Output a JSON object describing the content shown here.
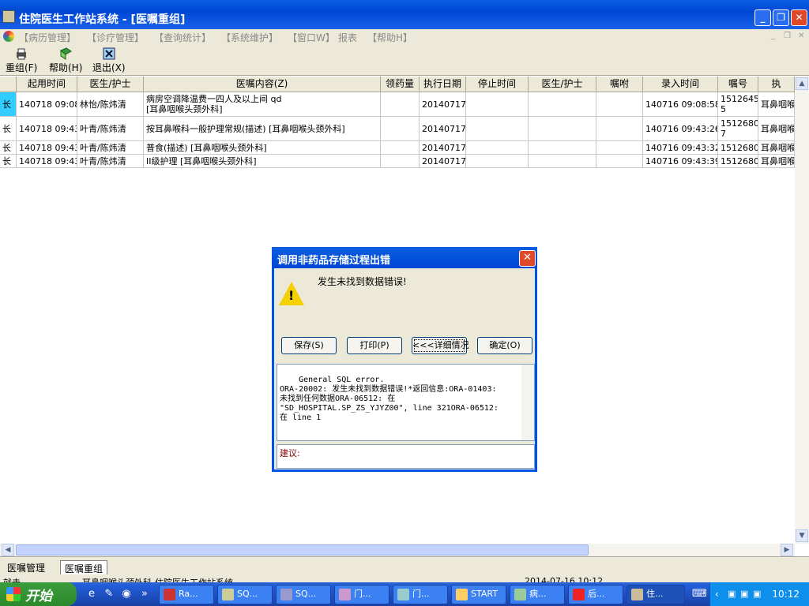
{
  "window": {
    "title": "住院医生工作站系统 - [医嘱重组]",
    "controls": [
      "_",
      "❐",
      "✕"
    ]
  },
  "menu": {
    "items": [
      "【病历管理】",
      "【诊疗管理】",
      "【查询统计】",
      "【系统维护】",
      "【窗口W】",
      "报表",
      "【帮助H】"
    ],
    "mdi_controls": [
      "_",
      "❐",
      "✕"
    ]
  },
  "toolbar": {
    "regroup_label": "重组(F)",
    "help_label": "帮助(H)",
    "exit_label": "退出(X)"
  },
  "grid": {
    "headers": [
      "",
      "起用时间",
      "医生/护士",
      "医嘱内容(Z)",
      "领药量",
      "执行日期",
      "停止时间",
      "医生/护士",
      "嘱咐",
      "录入时间",
      "嘱号",
      "执"
    ],
    "rows": [
      [
        "长",
        "140718 09:08",
        "林怡/陈炜清",
        "病房空调降温费一四人及以上间 qd\n[耳鼻咽喉头颈外科]",
        "",
        "20140717",
        "",
        "",
        "",
        "140716 09:08:58",
        "1512645\n5",
        "耳鼻咽喉"
      ],
      [
        "长",
        "140718 09:43",
        "叶青/陈炜清",
        "按耳鼻喉科一般护理常规(描述)  [耳鼻咽喉头颈外科]",
        "",
        "20140717",
        "",
        "",
        "",
        "140716 09:43:26",
        "1512680\n7",
        "耳鼻咽喉"
      ],
      [
        "长",
        "140718 09:43",
        "叶青/陈炜清",
        "普食(描述)  [耳鼻咽喉头颈外科]",
        "",
        "20140717",
        "",
        "",
        "",
        "140716 09:43:32",
        "15126808",
        "耳鼻咽喉"
      ],
      [
        "长",
        "140718 09:43",
        "叶青/陈炜清",
        "II级护理  [耳鼻咽喉头颈外科]",
        "",
        "20140717",
        "",
        "",
        "",
        "140716 09:43:39",
        "15126809",
        "耳鼻咽喉"
      ]
    ]
  },
  "tabs": [
    "医嘱管理",
    "医嘱重组"
  ],
  "statusbar": {
    "left": "就击",
    "middle": "耳鼻咽喉头颈外科-住院医生工作站系统",
    "right": "2014-07-16 10:12"
  },
  "dialog": {
    "title": "调用非药品存储过程出错",
    "message": "发生未找到数据错误!",
    "buttons": {
      "save": "保存(S)",
      "print": "打印(P)",
      "details": "<<<详细情况",
      "ok": "确定(O)"
    },
    "detail_text": "General SQL error.\nORA-20002: 发生未找到数据错误!*返回信息:ORA-01403:\n未找到任何数据ORA-06512: 在\n\"SD_HOSPITAL.SP_ZS_YJYZ00\", line 321ORA-06512:\n在 line 1",
    "suggestion_label": "建议:"
  },
  "taskbar": {
    "start_label": "开始",
    "items": [
      "Ra...",
      "SQ...",
      "SQ...",
      "门...",
      "门...",
      "START",
      "病...",
      "后...",
      "住..."
    ],
    "clock": "10:12"
  },
  "colors": {
    "xp_blue": "#0054e3",
    "row_highlight": "#33ccff",
    "suggestion_text": "#800000"
  }
}
